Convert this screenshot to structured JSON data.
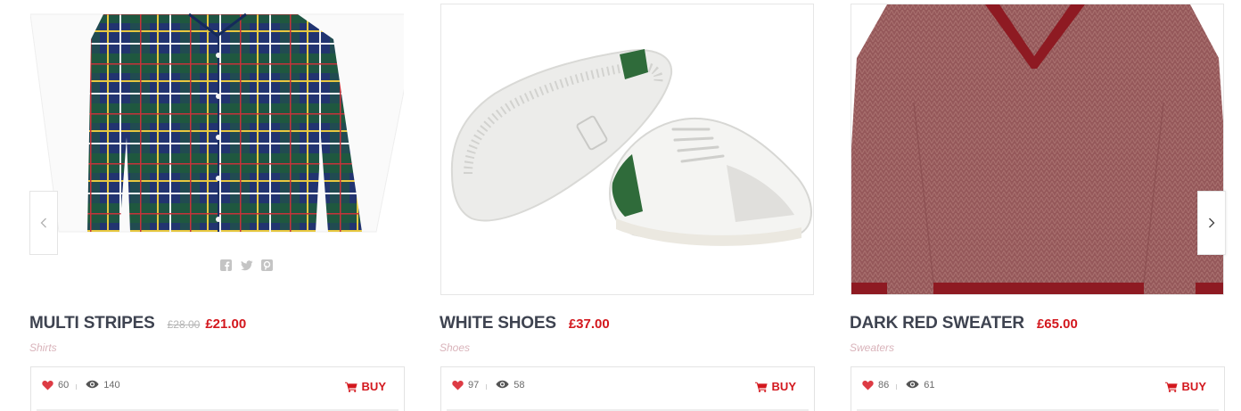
{
  "products": [
    {
      "title": "MULTI STRIPES",
      "old_price": "£28.00",
      "price": "£21.00",
      "category": "Shirts",
      "likes": "60",
      "views": "140",
      "buy_label": "BUY"
    },
    {
      "title": "WHITE SHOES",
      "price": "£37.00",
      "category": "Shoes",
      "likes": "97",
      "views": "58",
      "buy_label": "BUY"
    },
    {
      "title": "DARK RED SWEATER",
      "price": "£65.00",
      "category": "Sweaters",
      "likes": "86",
      "views": "61",
      "buy_label": "BUY"
    }
  ],
  "share_icons": [
    "facebook-icon",
    "twitter-icon",
    "pinterest-icon"
  ],
  "carousel": {
    "prev_icon": "chevron-left-icon",
    "next_icon": "chevron-right-icon"
  },
  "colors": {
    "price": "#d3171d",
    "title": "#3e4350",
    "category": "#d9b3ba"
  }
}
